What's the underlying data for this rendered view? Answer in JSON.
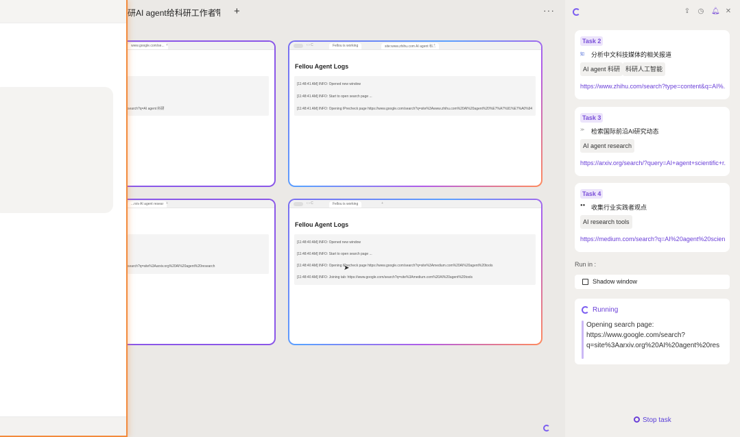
{
  "tab": {
    "title": "研AI agent给科研工作者带来",
    "close": "×",
    "add": "+"
  },
  "toolbar": {
    "more": "···"
  },
  "windows": {
    "top_left": {
      "url": "www.google.com/se...",
      "snippet": "search?q=AI agent 科研"
    },
    "top_right": {
      "tab1": "Fellou is working",
      "tab2": "site:www.zhihu.com AI agent 科...",
      "heading": "Fellou Agent Logs",
      "logs": [
        "[11:48:41 AM] INFO: Opened new window",
        "[11:48:41 AM] INFO: Start to open search page ...",
        "[11:48:41 AM] INFO: Opening IPrecheck page https://www.google.com/search?q=site%3Awww.zhihu.com%20AI%20agent%20%E7%A7%91%E7%A0%94"
      ]
    },
    "bottom_left": {
      "url": "...rxiv AI agent resear",
      "snippet": "search?q=site%3Aarxiv.org%20AI%20agent%20research"
    },
    "bottom_right": {
      "tab1": "Fellou is working",
      "heading": "Fellou Agent Logs",
      "logs": [
        "[11:48:40 AM] INFO: Opened new window",
        "[11:48:40 AM] INFO: Start to open search page ...",
        "[11:48:40 AM] INFO: Opening IPrecheck page https://www.google.com/search?q=site%3Amedium.com%20AI%20agent%20tools",
        "[11:48:40 AM] INFO: Joining tab: https://www.google.com/search?q=site%3Amedium.com%20AI%20agent%20tools"
      ]
    }
  },
  "sidebar": {
    "tasks": [
      {
        "badge": "Task 2",
        "icon": "知乎",
        "title": "分析中文科技媒体的相关报道",
        "chips": [
          "AI agent 科研",
          "科研人工智能"
        ],
        "link": "https://www.zhihu.com/search?type=content&q=AI%..."
      },
      {
        "badge": "Task 3",
        "icon": "arxiv",
        "title": "检索国际前沿AI研究动态",
        "chips": [
          "AI agent research"
        ],
        "link": "https://arxiv.org/search/?query=AI+agent+scientific+r..."
      },
      {
        "badge": "Task 4",
        "icon": "medium",
        "title": "收集行业实践者观点",
        "chips": [
          "AI research tools"
        ],
        "link": "https://medium.com/search?q=AI%20agent%20scien..."
      }
    ],
    "run_in_label": "Run in :",
    "shadow_window": "Shadow window",
    "running": {
      "status": "Running",
      "lines": [
        "Opening search page:",
        "https://www.google.com/search?",
        "q=site%3Aarxiv.org%20AI%20agent%20res"
      ]
    },
    "stop_task": "Stop task"
  },
  "colors": {
    "accent": "#6a3fd8",
    "panel_border": "#f28a3c",
    "window_border": "#8a56e8"
  }
}
